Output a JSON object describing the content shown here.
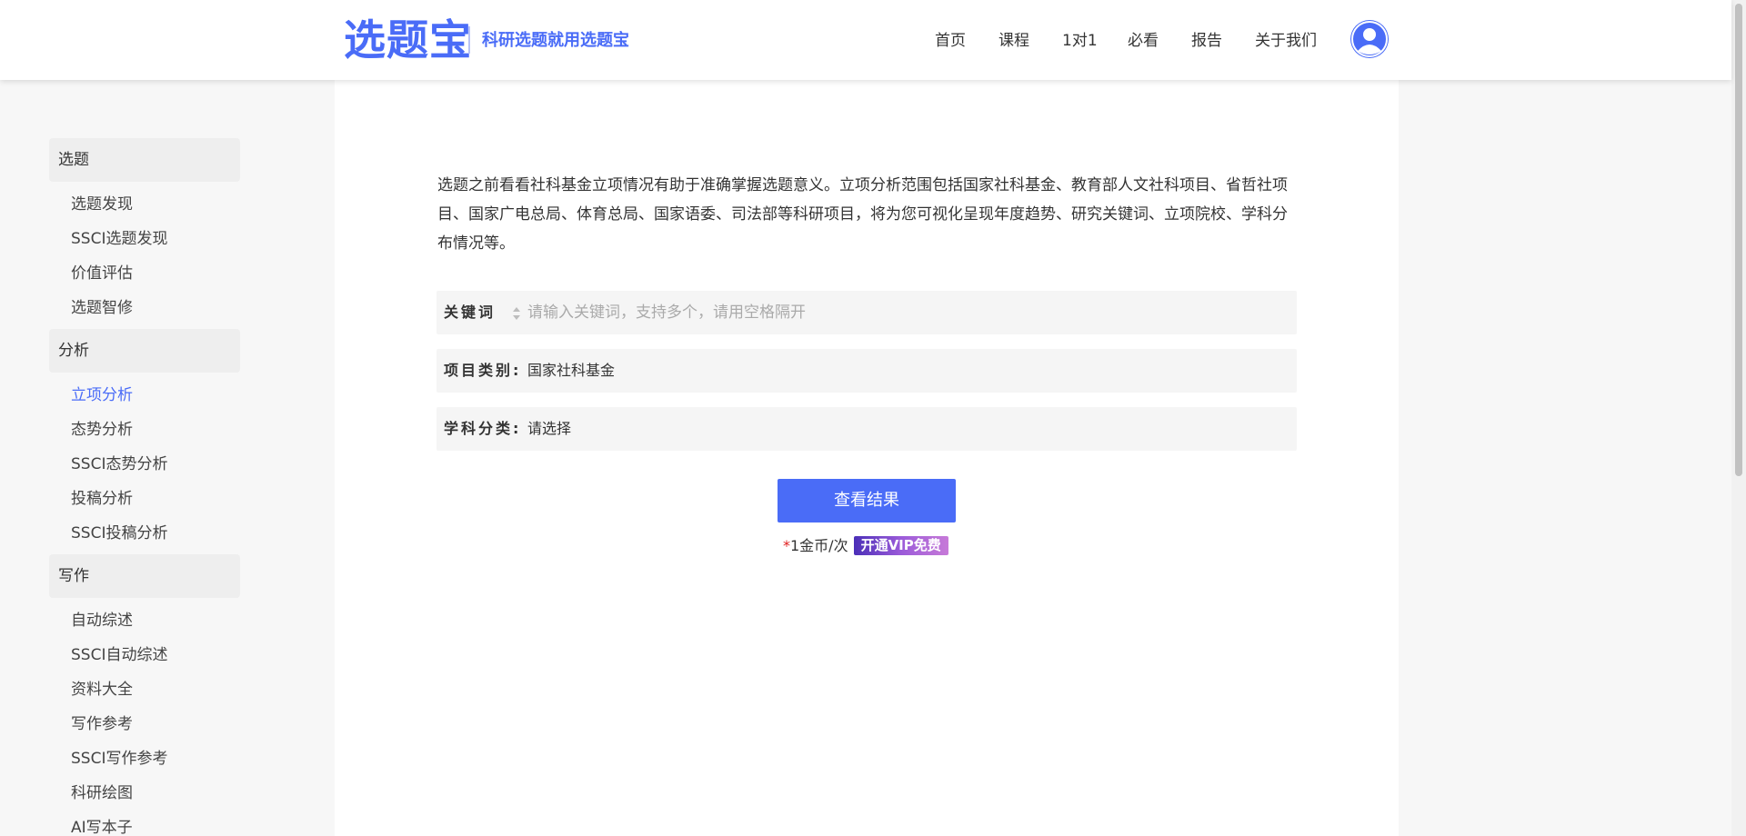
{
  "header": {
    "logo": "选题宝",
    "slogan": "科研选题就用选题宝",
    "nav": [
      {
        "label": "首页"
      },
      {
        "label": "课程"
      },
      {
        "label": "1对1"
      },
      {
        "label": "必看"
      },
      {
        "label": "报告"
      },
      {
        "label": "关于我们"
      }
    ],
    "avatar_icon": "user-avatar-icon"
  },
  "sidebar": {
    "groups": [
      {
        "title": "选题",
        "items": [
          "选题发现",
          "SSCI选题发现",
          "价值评估",
          "选题智修"
        ]
      },
      {
        "title": "分析",
        "items": [
          "立项分析",
          "态势分析",
          "SSCI态势分析",
          "投稿分析",
          "SSCI投稿分析"
        ]
      },
      {
        "title": "写作",
        "items": [
          "自动综述",
          "SSCI自动综述",
          "资料大全",
          "写作参考",
          "SSCI写作参考",
          "科研绘图",
          "AI写本子"
        ]
      }
    ],
    "active_item": "立项分析"
  },
  "main": {
    "intro": "选题之前看看社科基金立项情况有助于准确掌握选题意义。立项分析范围包括国家社科基金、教育部人文社科项目、省哲社项目、国家广电总局、体育总局、国家语委、司法部等科研项目，将为您可视化呈现年度趋势、研究关键词、立项院校、学科分布情况等。",
    "keyword": {
      "label": "关键词",
      "value": "",
      "placeholder": "请输入关键词，支持多个，请用空格隔开"
    },
    "project_type": {
      "label": "项目类别:",
      "value": "国家社科基金"
    },
    "subject": {
      "label": "学科分类:",
      "value": "请选择"
    },
    "submit_label": "查看结果",
    "price_asterisk": "*",
    "price_text": "1金币/次",
    "vip_label": "开通VIP免费"
  },
  "colors": {
    "accent": "#4a6cf7",
    "active": "#4a6cf7",
    "asterisk": "#e02020"
  }
}
